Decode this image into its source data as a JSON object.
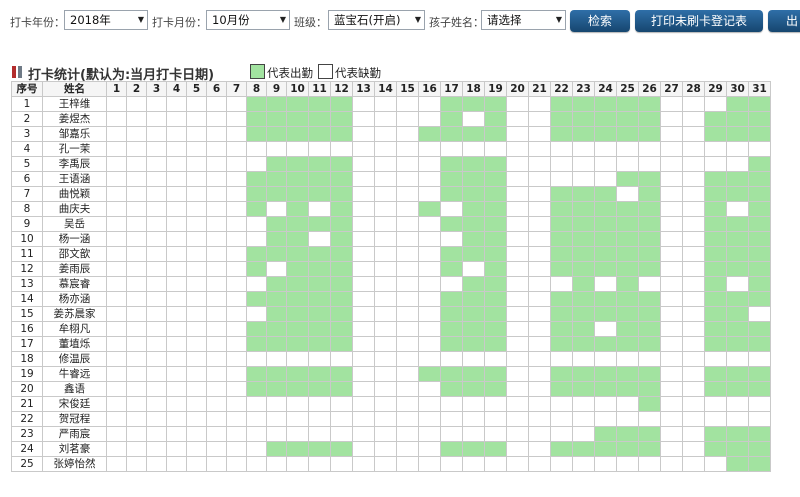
{
  "filters": {
    "year_label": "打卡年份：",
    "year_value": "2018年",
    "month_label": "打卡月份：",
    "month_value": "10月份",
    "class_label": "班级：",
    "class_value": "蓝宝石(开启)",
    "child_label": "孩子姓名：",
    "child_value": "请选择"
  },
  "buttons": {
    "search": "检索",
    "print": "打印未刷卡登记表",
    "export": "出"
  },
  "section": {
    "title": "打卡统计(默认为:当月打卡日期)",
    "legend_present": "代表出勤",
    "legend_absent": "代表缺勤"
  },
  "colors": {
    "present": "#a2e3a0",
    "absent": "#ffffff",
    "button": "#1f5a8e"
  },
  "table": {
    "col_index": "序号",
    "col_name": "姓名",
    "days": [
      1,
      2,
      3,
      4,
      5,
      6,
      7,
      8,
      9,
      10,
      11,
      12,
      13,
      14,
      15,
      16,
      17,
      18,
      19,
      20,
      21,
      22,
      23,
      24,
      25,
      26,
      27,
      28,
      29,
      30,
      31
    ],
    "rows": [
      {
        "no": 1,
        "name": "王梓维",
        "present": [
          8,
          9,
          10,
          11,
          12,
          17,
          18,
          19,
          22,
          23,
          24,
          25,
          26,
          30,
          31
        ]
      },
      {
        "no": 2,
        "name": "姜煜杰",
        "present": [
          8,
          9,
          10,
          11,
          12,
          17,
          19,
          22,
          23,
          24,
          25,
          26,
          29,
          30,
          31
        ]
      },
      {
        "no": 3,
        "name": "邹嘉乐",
        "present": [
          8,
          9,
          10,
          11,
          12,
          16,
          17,
          18,
          19,
          22,
          23,
          24,
          25,
          26,
          29,
          30,
          31
        ]
      },
      {
        "no": 4,
        "name": "孔一茉",
        "present": []
      },
      {
        "no": 5,
        "name": "李禹辰",
        "present": [
          9,
          10,
          11,
          12,
          17,
          18,
          19,
          31
        ]
      },
      {
        "no": 6,
        "name": "王语涵",
        "present": [
          8,
          9,
          10,
          11,
          12,
          17,
          18,
          19,
          25,
          26,
          29,
          30,
          31
        ]
      },
      {
        "no": 7,
        "name": "曲悦颖",
        "present": [
          8,
          9,
          10,
          11,
          12,
          17,
          18,
          19,
          22,
          23,
          24,
          26,
          29,
          30,
          31
        ]
      },
      {
        "no": 8,
        "name": "曲庆夫",
        "present": [
          8,
          10,
          12,
          16,
          18,
          19,
          22,
          23,
          24,
          25,
          26,
          29,
          31
        ]
      },
      {
        "no": 9,
        "name": "吴岳",
        "present": [
          9,
          10,
          11,
          12,
          17,
          18,
          19,
          22,
          23,
          24,
          25,
          26,
          29,
          30,
          31
        ]
      },
      {
        "no": 10,
        "name": "杨一涵",
        "present": [
          9,
          10,
          12,
          18,
          19,
          22,
          23,
          24,
          25,
          26,
          29,
          30,
          31
        ]
      },
      {
        "no": 11,
        "name": "邵文歆",
        "present": [
          8,
          9,
          10,
          11,
          12,
          17,
          18,
          19,
          22,
          23,
          24,
          25,
          26,
          29,
          30,
          31
        ]
      },
      {
        "no": 12,
        "name": "姜雨辰",
        "present": [
          8,
          10,
          11,
          12,
          17,
          19,
          22,
          23,
          24,
          25,
          26,
          29,
          30,
          31
        ]
      },
      {
        "no": 13,
        "name": "慕宸睿",
        "present": [
          9,
          10,
          11,
          12,
          18,
          19,
          23,
          25,
          29,
          31
        ]
      },
      {
        "no": 14,
        "name": "杨亦涵",
        "present": [
          8,
          9,
          10,
          11,
          12,
          17,
          18,
          19,
          22,
          23,
          24,
          25,
          26,
          29,
          30,
          31
        ]
      },
      {
        "no": 15,
        "name": "姜苏晨家",
        "present": [
          9,
          10,
          11,
          12,
          17,
          18,
          19,
          22,
          23,
          24,
          25,
          26,
          29,
          30
        ]
      },
      {
        "no": 16,
        "name": "牟栩凡",
        "present": [
          8,
          9,
          10,
          11,
          12,
          17,
          18,
          19,
          22,
          23,
          25,
          26,
          29,
          30,
          31
        ]
      },
      {
        "no": 17,
        "name": "董埴烁",
        "present": [
          8,
          9,
          10,
          11,
          12,
          17,
          18,
          19,
          22,
          23,
          24,
          25,
          26,
          29,
          30,
          31
        ]
      },
      {
        "no": 18,
        "name": "修温辰",
        "present": []
      },
      {
        "no": 19,
        "name": "牛睿远",
        "present": [
          8,
          9,
          10,
          11,
          12,
          16,
          17,
          18,
          19,
          22,
          23,
          24,
          25,
          26,
          29,
          30,
          31
        ]
      },
      {
        "no": 20,
        "name": "鑫语",
        "present": [
          8,
          9,
          10,
          11,
          12,
          17,
          18,
          19,
          22,
          23,
          24,
          25,
          26,
          29,
          30,
          31
        ]
      },
      {
        "no": 21,
        "name": "宋俊廷",
        "present": [
          26
        ]
      },
      {
        "no": 22,
        "name": "贺冠程",
        "present": []
      },
      {
        "no": 23,
        "name": "严雨宸",
        "present": [
          24,
          25,
          26,
          29,
          30,
          31
        ]
      },
      {
        "no": 24,
        "name": "刘茗豪",
        "present": [
          9,
          10,
          11,
          12,
          17,
          18,
          19,
          22,
          23,
          24,
          25,
          26,
          29,
          30,
          31
        ]
      },
      {
        "no": 25,
        "name": "张婷怡然",
        "present": [
          30,
          31
        ]
      }
    ]
  }
}
